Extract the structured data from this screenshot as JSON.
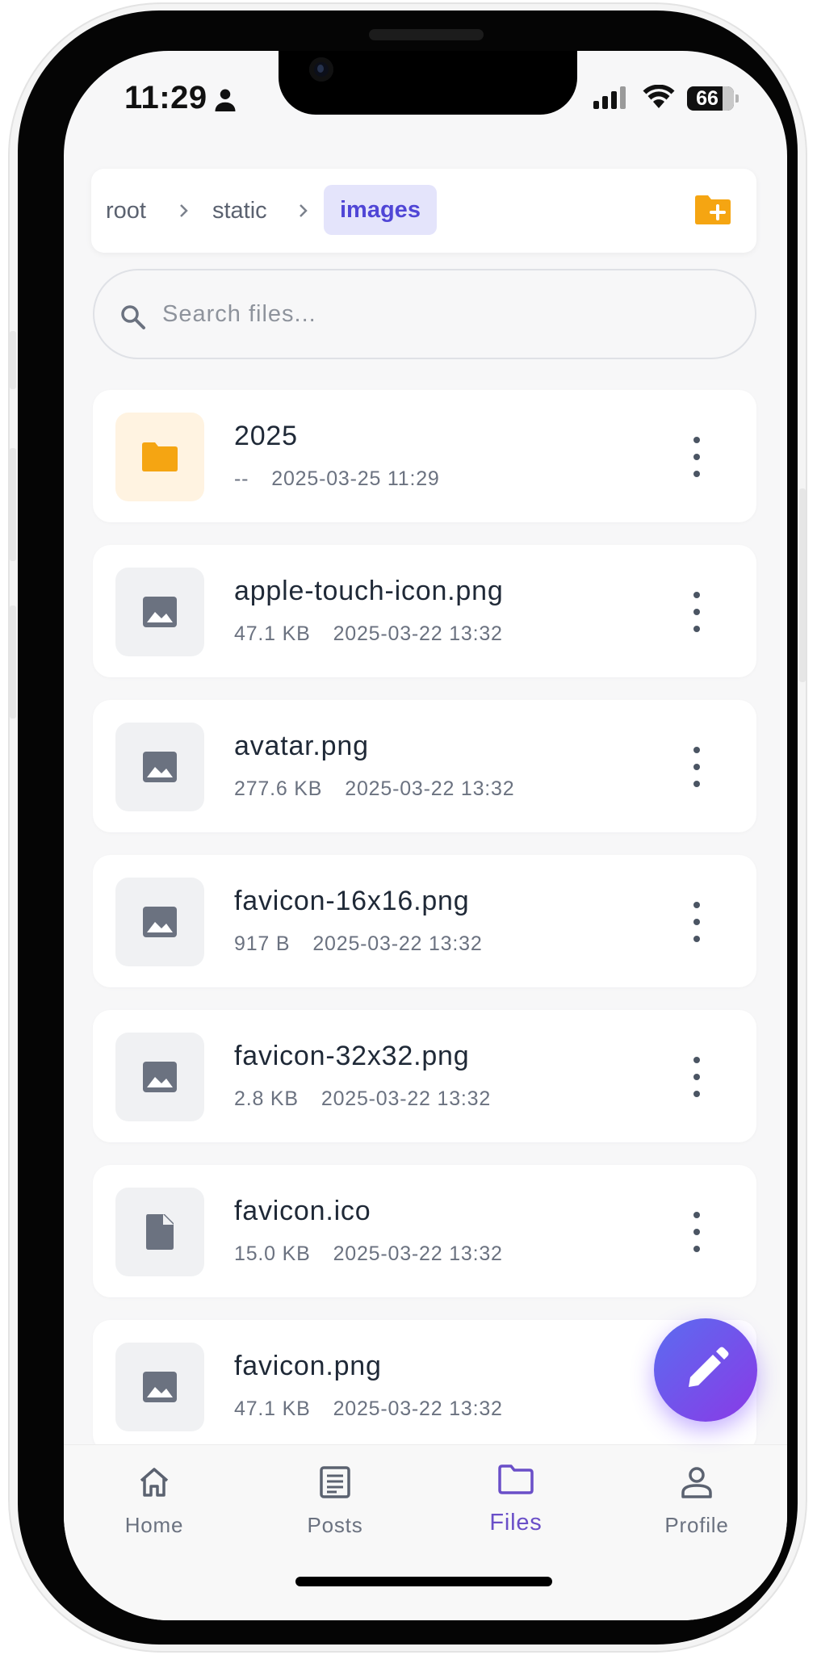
{
  "status_bar": {
    "time": "11:29",
    "battery": "66"
  },
  "breadcrumb": {
    "items": [
      "root",
      "static"
    ],
    "active": "images"
  },
  "search": {
    "placeholder": "Search files..."
  },
  "files": [
    {
      "name": "2025",
      "size": "--",
      "modified": "2025-03-25 11:29",
      "type": "folder",
      "icon": "folder-icon"
    },
    {
      "name": "apple-touch-icon.png",
      "size": "47.1 KB",
      "modified": "2025-03-22 13:32",
      "type": "image",
      "icon": "image-icon"
    },
    {
      "name": "avatar.png",
      "size": "277.6 KB",
      "modified": "2025-03-22 13:32",
      "type": "image",
      "icon": "image-icon"
    },
    {
      "name": "favicon-16x16.png",
      "size": "917 B",
      "modified": "2025-03-22 13:32",
      "type": "image",
      "icon": "image-icon"
    },
    {
      "name": "favicon-32x32.png",
      "size": "2.8 KB",
      "modified": "2025-03-22 13:32",
      "type": "image",
      "icon": "image-icon"
    },
    {
      "name": "favicon.ico",
      "size": "15.0 KB",
      "modified": "2025-03-22 13:32",
      "type": "file",
      "icon": "file-icon"
    },
    {
      "name": "favicon.png",
      "size": "47.1 KB",
      "modified": "2025-03-22 13:32",
      "type": "image",
      "icon": "image-icon"
    }
  ],
  "nav": {
    "items": [
      {
        "label": "Home",
        "icon": "home-icon"
      },
      {
        "label": "Posts",
        "icon": "posts-icon"
      },
      {
        "label": "Files",
        "icon": "folder-icon",
        "active": true
      },
      {
        "label": "Profile",
        "icon": "profile-icon"
      }
    ]
  },
  "colors": {
    "accent": "#5046d6",
    "active_nav": "#6a4fc8",
    "folder": "#f5a512",
    "fab_start": "#5b6cf0",
    "fab_end": "#8a3ae6"
  }
}
